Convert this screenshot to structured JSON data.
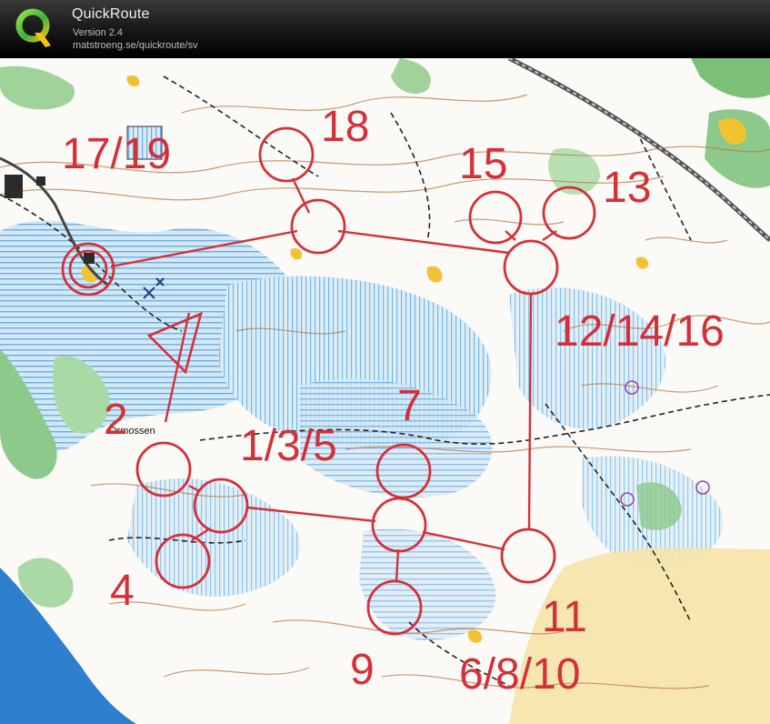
{
  "app": {
    "name": "QuickRoute",
    "version": "Version 2.4",
    "url": "matstroeng.se/quickroute/sv"
  },
  "map": {
    "place_name": "Ormossen",
    "course_color": "#d3303a",
    "control_labels": {
      "c17_19": "17/19",
      "c18": "18",
      "c15": "15",
      "c13": "13",
      "c12_14_16": "12/14/16",
      "c2": "2",
      "c1_3_5": "1/3/5",
      "c7": "7",
      "c4": "4",
      "c11": "11",
      "c9": "9",
      "c6_8_10": "6/8/10"
    }
  },
  "colors": {
    "water_lake": "#2f7fcf",
    "marsh_blue": "#9cc8ec",
    "vegetation_green": "#8cc98a",
    "open_yellow": "#f1c232",
    "contour_brown": "#b47a4a",
    "title_text": "#f0f0f0"
  }
}
